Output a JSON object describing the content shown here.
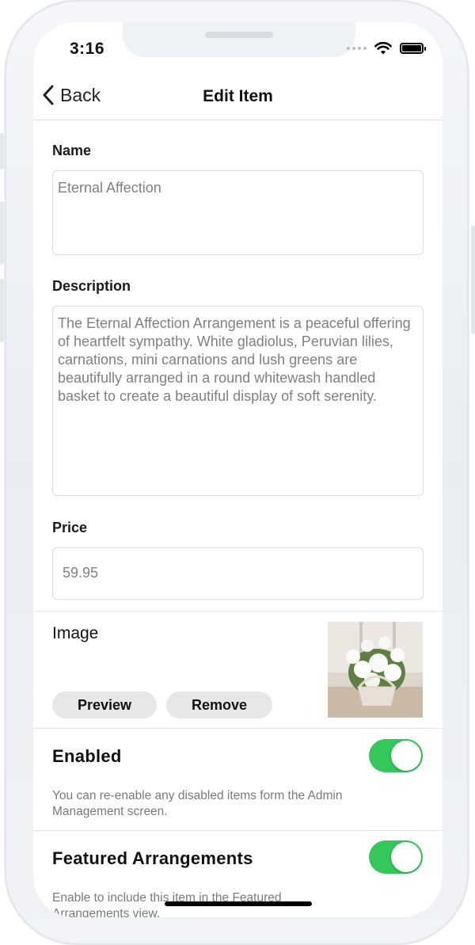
{
  "status_bar": {
    "time": "3:16"
  },
  "nav": {
    "back_label": "Back",
    "title": "Edit Item"
  },
  "form": {
    "name": {
      "label": "Name",
      "value": "Eternal Affection"
    },
    "description": {
      "label": "Description",
      "value": "The Eternal Affection Arrangement is a peaceful offering of heartfelt sympathy. White gladiolus, Peruvian lilies, carnations, mini carnations and lush greens are beautifully arranged in a round whitewash handled basket to create a beautiful display of soft serenity."
    },
    "price": {
      "label": "Price",
      "value": "59.95"
    }
  },
  "image_section": {
    "label": "Image",
    "preview_label": "Preview",
    "remove_label": "Remove"
  },
  "enabled": {
    "label": "Enabled",
    "on": true,
    "hint": "You can re-enable any disabled items form the Admin Management screen."
  },
  "featured": {
    "label": "Featured Arrangements",
    "on": true,
    "hint": "Enable to include this item in the Featured Arrangements view."
  },
  "colors": {
    "toggle_on": "#34c759",
    "pill_bg": "#e7e7ea"
  }
}
